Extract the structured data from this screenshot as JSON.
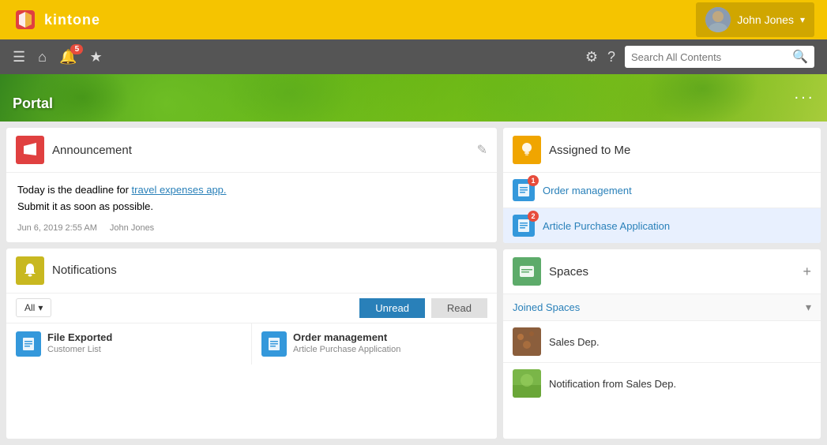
{
  "topBar": {
    "logoText": "kintone",
    "user": {
      "name": "John Jones",
      "chevron": "▾"
    }
  },
  "navBar": {
    "notificationBadge": "5",
    "searchPlaceholder": "Search All Contents"
  },
  "portal": {
    "title": "Portal",
    "moreLabel": "···"
  },
  "announcement": {
    "title": "Announcement",
    "bodyLine1": "Today is the deadline for ",
    "bodyLink": "travel expenses app.",
    "bodyLine2": "Submit it as soon as possible.",
    "meta": {
      "date": "Jun 6, 2019 2:55 AM",
      "author": "John Jones"
    }
  },
  "notifications": {
    "title": "Notifications",
    "filterLabel": "All",
    "tabs": {
      "unread": "Unread",
      "read": "Read"
    },
    "items": [
      {
        "title": "File Exported",
        "subtitle": "Customer List"
      },
      {
        "title": "Order management",
        "subtitle": "Article Purchase Application"
      }
    ]
  },
  "assignedToMe": {
    "title": "Assigned to Me",
    "items": [
      {
        "name": "Order management",
        "badge": "1"
      },
      {
        "name": "Article Purchase Application",
        "badge": "2"
      }
    ]
  },
  "spaces": {
    "title": "Spaces",
    "addLabel": "+",
    "joinedLabel": "Joined Spaces",
    "items": [
      {
        "name": "Sales Dep.",
        "color": "#8B5E3C"
      },
      {
        "name": "Notification from Sales Dep.",
        "color": "#7ab648"
      }
    ]
  }
}
